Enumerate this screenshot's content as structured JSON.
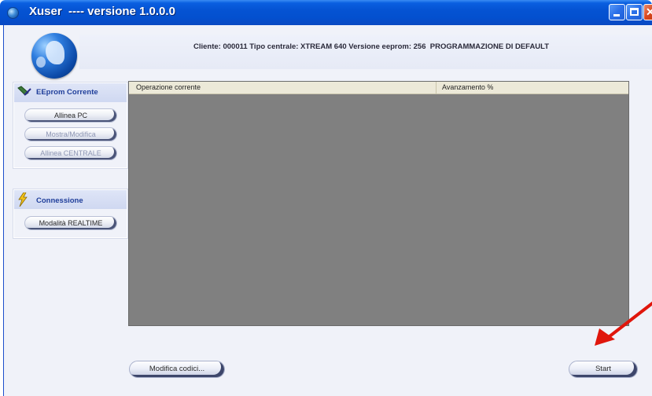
{
  "window": {
    "title": "Xuser  ---- versione 1.0.0.0",
    "controls": [
      "minimize-icon",
      "maximize-icon",
      "close-icon"
    ]
  },
  "header": {
    "status_line": "Cliente: 000011 Tipo centrale: XTREAM 640 Versione eeprom: 256  PROGRAMMAZIONE DI DEFAULT"
  },
  "sidebar": {
    "eeprom": {
      "title": "EEprom Corrente",
      "icon": "eeprom-icon",
      "buttons": [
        {
          "label": "Allinea PC",
          "enabled": true
        },
        {
          "label": "Mostra/Modifica",
          "enabled": false
        },
        {
          "label": "Allinea CENTRALE",
          "enabled": false
        }
      ]
    },
    "connection": {
      "title": "Connessione",
      "icon": "lightning-icon",
      "buttons": [
        {
          "label": "Modalità REALTIME",
          "enabled": true
        }
      ]
    }
  },
  "operations_table": {
    "columns": [
      "Operazione corrente",
      "Avanzamento %"
    ],
    "rows": []
  },
  "footer": {
    "edit_codes_label": "Modifica codici...",
    "start_label": "Start"
  },
  "colors": {
    "titlebar": "#0553d3",
    "table_background": "#808080",
    "panel_title": "#1f3e9a",
    "annotation_arrow": "#e0160c"
  }
}
